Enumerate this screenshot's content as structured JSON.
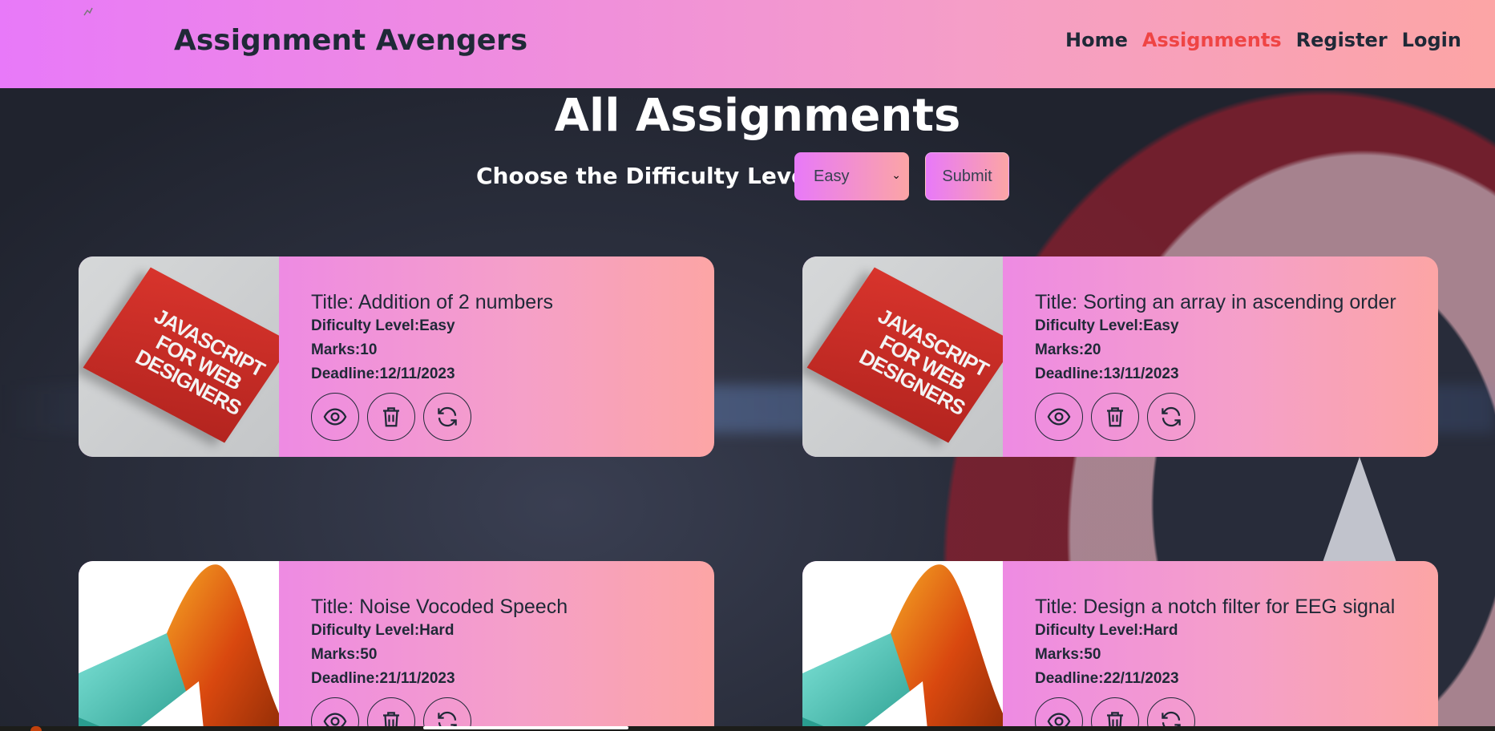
{
  "header": {
    "brand": "Assignment Avengers",
    "nav": [
      {
        "label": "Home",
        "active": false
      },
      {
        "label": "Assignments",
        "active": true
      },
      {
        "label": "Register",
        "active": false
      },
      {
        "label": "Login",
        "active": false
      }
    ]
  },
  "main": {
    "title": "All Assignments",
    "filter": {
      "label": "Choose the Difficulty Level",
      "selected": "Easy",
      "submit_label": "Submit"
    },
    "cards": [
      {
        "title": "Title: Addition of 2 numbers",
        "difficulty": "Dificulty Level:Easy",
        "marks": "Marks:10",
        "deadline": "Deadline:12/11/2023",
        "image": "javascript-book"
      },
      {
        "title": "Title: Sorting an array in ascending order",
        "difficulty": "Dificulty Level:Easy",
        "marks": "Marks:20",
        "deadline": "Deadline:13/11/2023",
        "image": "javascript-book"
      },
      {
        "title": "Title: Noise Vocoded Speech",
        "difficulty": "Dificulty Level:Hard",
        "marks": "Marks:50",
        "deadline": "Deadline:21/11/2023",
        "image": "matlab-logo"
      },
      {
        "title": "Title: Design a notch filter for EEG signal",
        "difficulty": "Dificulty Level:Hard",
        "marks": "Marks:50",
        "deadline": "Deadline:22/11/2023",
        "image": "matlab-logo"
      }
    ],
    "book_cover_text": "JAVASCRIPT FOR WEB DESIGNERS"
  },
  "icons": {
    "view": "eye-icon",
    "delete": "trash-icon",
    "update": "refresh-icon"
  },
  "colors": {
    "header_gradient_start": "#e879f9",
    "header_gradient_end": "#fca5a5",
    "active_nav": "#ef4444",
    "text_dark": "#1f2937"
  }
}
